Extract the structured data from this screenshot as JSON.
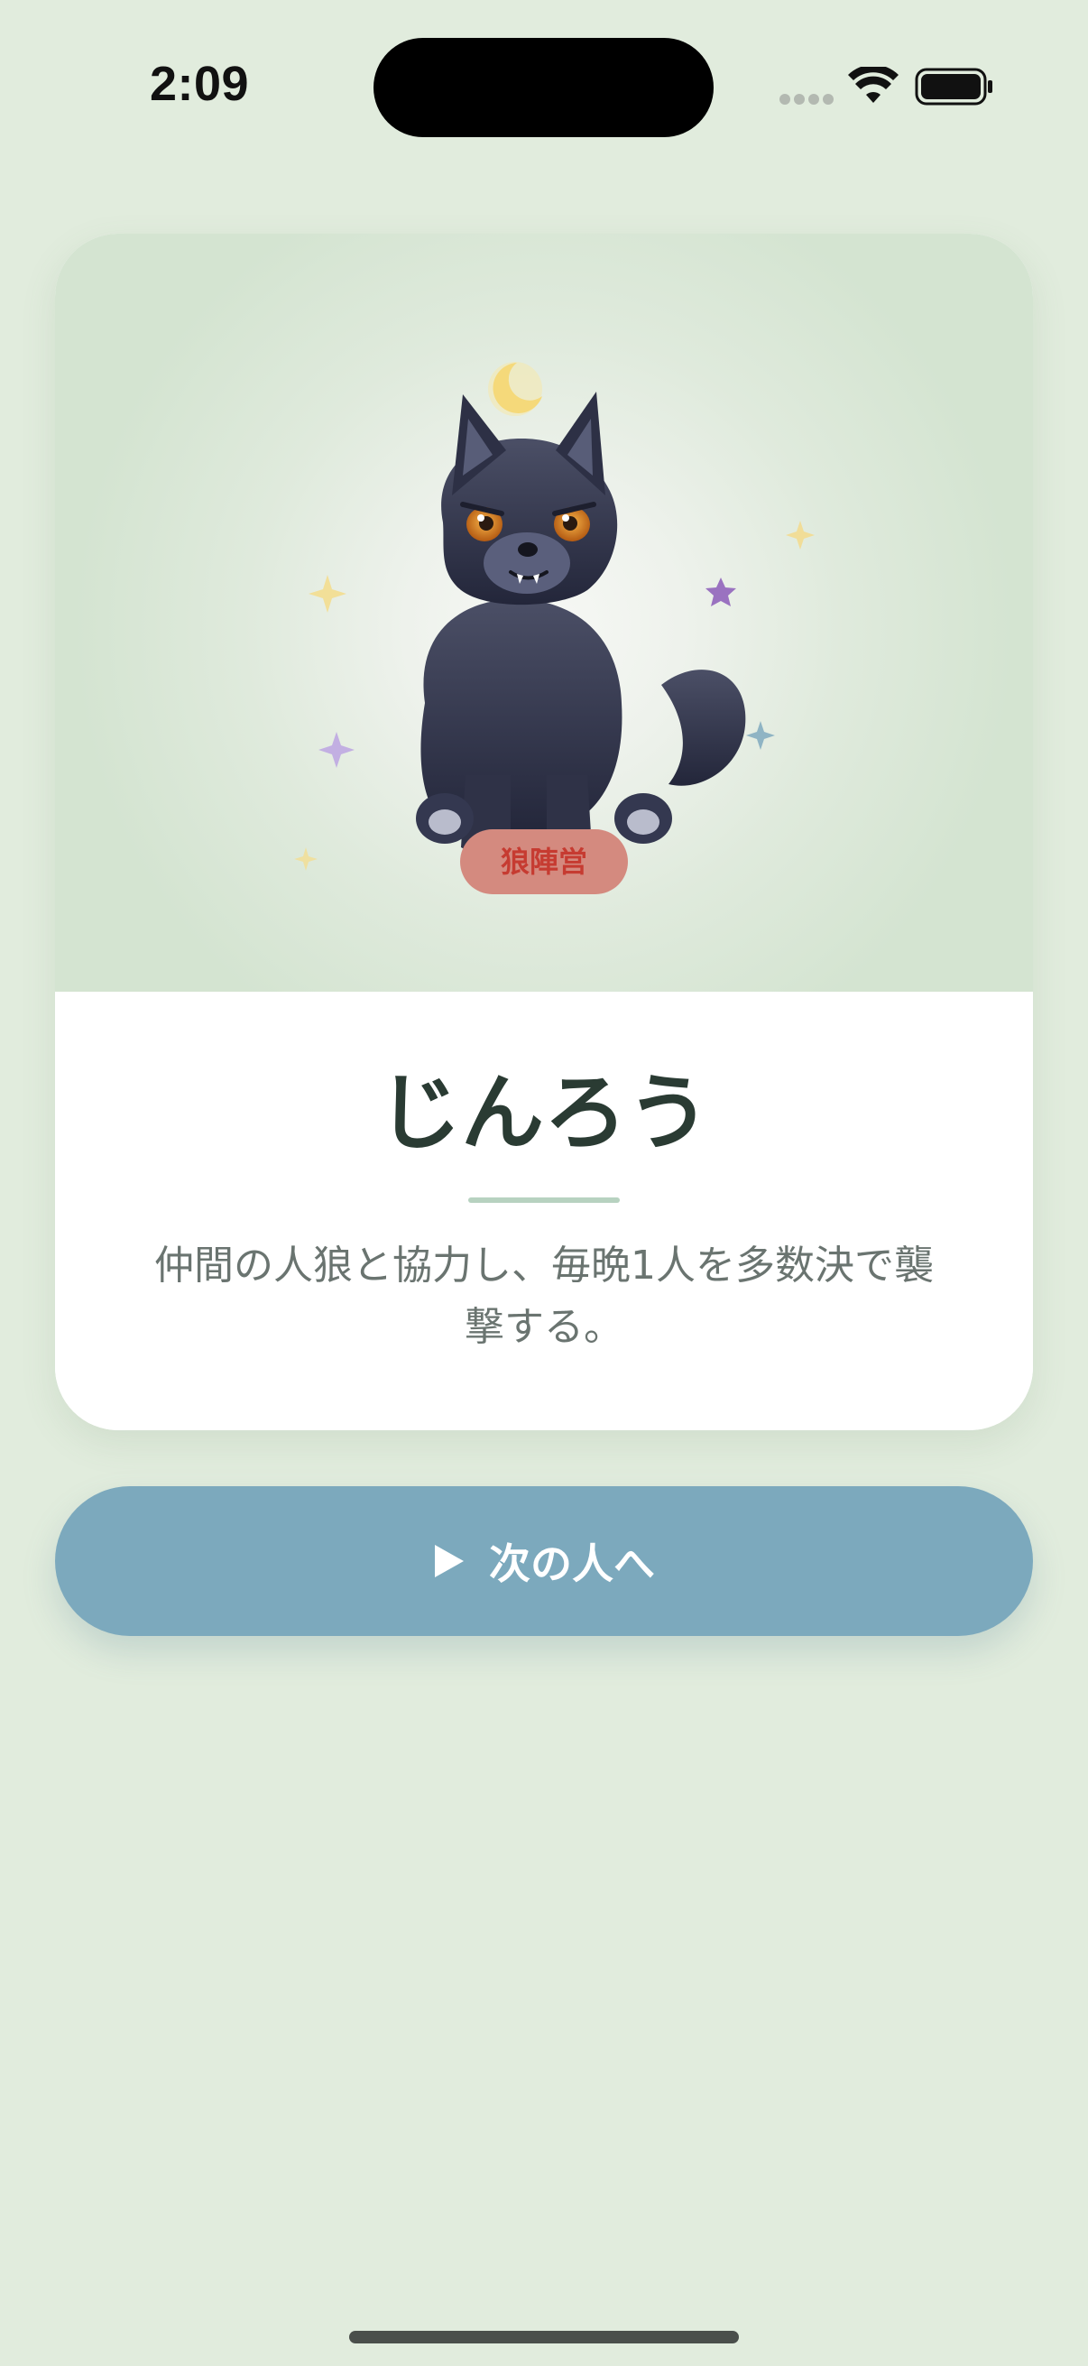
{
  "status_bar": {
    "time": "2:09",
    "icons": [
      "signal-icon",
      "wifi-icon",
      "battery-icon"
    ]
  },
  "card": {
    "illustration": "werewolf-icon",
    "faction_badge": "狼陣営",
    "role_name": "じんろう",
    "description": "仲間の人狼と協力し、毎晩1人を多数決で襲撃する。"
  },
  "next_button": {
    "icon": "play-icon",
    "label": "次の人へ"
  },
  "colors": {
    "background": "#e1ecdd",
    "button": "#7ca9bd",
    "badge": "#d48a7f",
    "badge_text": "#c63b31",
    "title": "#2a3b33",
    "accent_divider": "#b7d2c0"
  }
}
